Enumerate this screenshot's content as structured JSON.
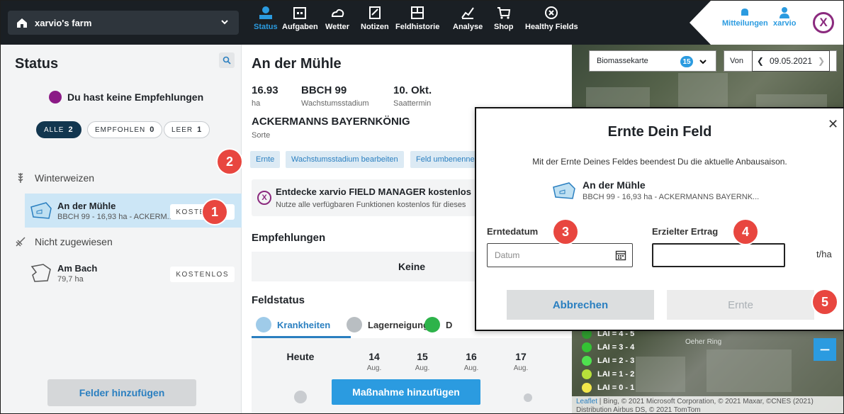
{
  "topbar": {
    "farm_name": "xarvio's farm",
    "nav": [
      {
        "label": "Status",
        "icon": "status-icon"
      },
      {
        "label": "Aufgaben",
        "icon": "calendar-icon"
      },
      {
        "label": "Wetter",
        "icon": "weather-icon"
      },
      {
        "label": "Notizen",
        "icon": "note-icon"
      },
      {
        "label": "Feldhistorie",
        "icon": "history-icon"
      },
      {
        "label": "Analyse",
        "icon": "analysis-icon"
      },
      {
        "label": "Shop",
        "icon": "cart-icon"
      },
      {
        "label": "Healthy Fields",
        "icon": "healthy-fields-icon"
      }
    ],
    "notifications_label": "Mitteilungen",
    "user_label": "xarvio",
    "accent": "#2b9be0"
  },
  "sidebar": {
    "title": "Status",
    "no_recommendations": "Du hast keine Empfehlungen",
    "filters": [
      {
        "label": "ALLE",
        "count": "2"
      },
      {
        "label": "EMPFOHLEN",
        "count": "0"
      },
      {
        "label": "LEER",
        "count": "1"
      }
    ],
    "group_winter": "Winterweizen",
    "field1": {
      "name": "An der Mühle",
      "sub": "BBCH 99 - 16,93 ha - ACKERM...",
      "tag": "KOSTENLOS"
    },
    "group_unassigned": "Nicht zugewiesen",
    "field2": {
      "name": "Am Bach",
      "sub": "79,7 ha",
      "tag": "KOSTENLOS"
    },
    "add_fields": "Felder hinzufügen"
  },
  "field": {
    "title": "An der Mühle",
    "area_value": "16.93",
    "area_label": "ha",
    "bbch_value": "BBCH 99",
    "bbch_label": "Wachstumsstadium",
    "sowing_value": "10. Okt.",
    "sowing_label": "Saattermin",
    "variety": "ACKERMANNS BAYERNKÖNIG",
    "variety_label": "Sorte",
    "actions": [
      "Ernte",
      "Wachstumsstadium bearbeiten",
      "Feld umbenennen"
    ],
    "promo_title": "Entdecke xarvio FIELD MANAGER kostenlos",
    "promo_sub": "Nutze alle verfügbaren Funktionen kostenlos für dieses",
    "recommendations_title": "Empfehlungen",
    "recommendations_empty": "Keine",
    "status_title": "Feldstatus",
    "tabs": [
      "Krankheiten",
      "Lagerneigung",
      "D"
    ],
    "days": [
      {
        "d": "Heute",
        "m": ""
      },
      {
        "d": "14",
        "m": "Aug."
      },
      {
        "d": "15",
        "m": "Aug."
      },
      {
        "d": "16",
        "m": "Aug."
      },
      {
        "d": "17",
        "m": "Aug."
      }
    ],
    "add_measure": "Maßnahme hinzufügen"
  },
  "map": {
    "layer": "Biomassekarte",
    "layer_count": "15",
    "from_label": "Von",
    "date": "09.05.2021",
    "legend": [
      {
        "label": "LAI = 4 - 5",
        "color": "#2e9a2e"
      },
      {
        "label": "LAI = 3 - 4",
        "color": "#34c234"
      },
      {
        "label": "LAI = 2 - 3",
        "color": "#4fe04f"
      },
      {
        "label": "LAI = 1 - 2",
        "color": "#b7e03a"
      },
      {
        "label": "LAI = 0 - 1",
        "color": "#f2e64a"
      }
    ],
    "zoom_out": "−",
    "road_label": "Oeher Ring",
    "attribution_leaflet": "Leaflet",
    "attribution_line1": " | Bing, © 2021 Microsoft Corporation, © 2021 Maxar, ©CNES (2021)",
    "attribution_line2": "Distribution Airbus DS, © 2021 TomTom"
  },
  "modal": {
    "title": "Ernte Dein Feld",
    "description": "Mit der Ernte Deines Feldes beendest Du die aktuelle Anbausaison.",
    "field_name": "An der Mühle",
    "field_sub": "BBCH 99 - 16,93 ha - ACKERMANNS BAYERNK...",
    "date_label": "Erntedatum",
    "date_placeholder": "Datum",
    "yield_label": "Erzielter Ertrag",
    "yield_unit": "t/ha",
    "cancel": "Abbrechen",
    "confirm": "Ernte"
  },
  "steps": [
    "1",
    "2",
    "3",
    "4",
    "5"
  ]
}
